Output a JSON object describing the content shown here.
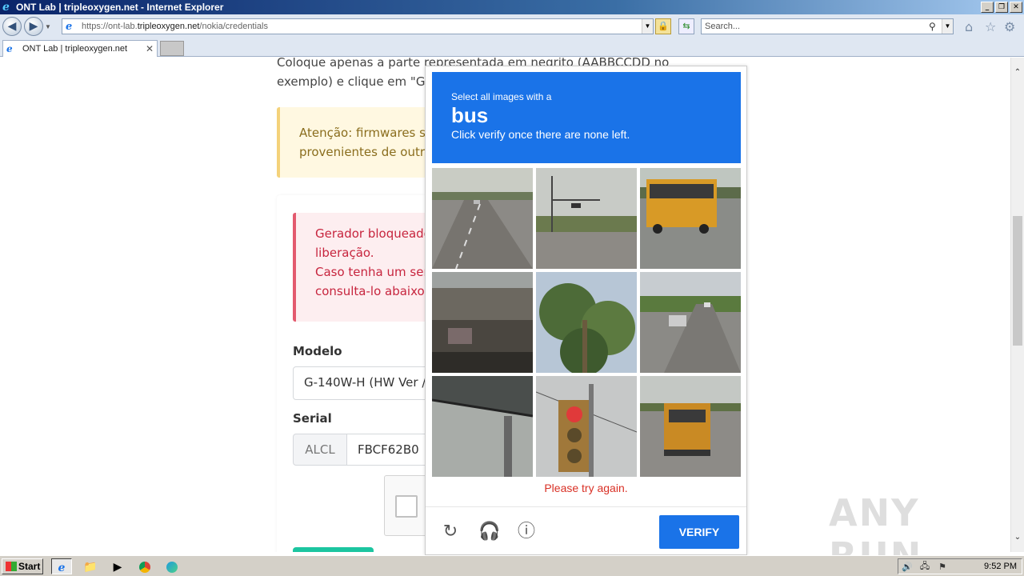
{
  "window": {
    "title": "ONT Lab | tripleoxygen.net - Internet Explorer",
    "buttons": [
      "_",
      "❐",
      "✕"
    ]
  },
  "address_bar": {
    "url_prefix": "https://ont-lab.",
    "url_host": "tripleoxygen.net",
    "url_path": "/nokia/credentials",
    "search_placeholder": "Search..."
  },
  "tabs": [
    {
      "label": "ONT Lab | tripleoxygen.net"
    }
  ],
  "page": {
    "intro": "Coloque apenas a parte representada em negrito (AABBCCDD no exemplo) e clique em \"Gerar ou consu",
    "warning": "Atenção: firmwares ser\nprovenientes de outro",
    "danger": "Gerador bloqueado\nliberação.\nCaso tenha um seria\nconsulta-lo abaixo s",
    "modelo_label": "Modelo",
    "modelo_value": "G-140W-H (HW Ver /",
    "serial_label": "Serial",
    "serial_prefix": "ALCL",
    "serial_value": "FBCF62B0"
  },
  "captcha": {
    "instruction_small": "Select all images with a",
    "target": "bus",
    "instruction_sub": "Click verify once there are none left.",
    "error": "Please try again.",
    "verify_label": "VERIFY",
    "footer_icons": [
      "refresh-icon",
      "audio-icon",
      "info-icon"
    ],
    "tiles": [
      {
        "subject": "road"
      },
      {
        "subject": "intersection"
      },
      {
        "subject": "bus"
      },
      {
        "subject": "building"
      },
      {
        "subject": "palm trees"
      },
      {
        "subject": "highway"
      },
      {
        "subject": "overpass"
      },
      {
        "subject": "traffic light"
      },
      {
        "subject": "bus"
      }
    ]
  },
  "watermark": "ANY RUN",
  "taskbar": {
    "start_label": "Start",
    "clock": "9:52 PM"
  },
  "colors": {
    "captcha_blue": "#1a73e8",
    "error_red": "#d93025",
    "warning_text": "#8a6d1d",
    "danger_text": "#c7253e"
  }
}
